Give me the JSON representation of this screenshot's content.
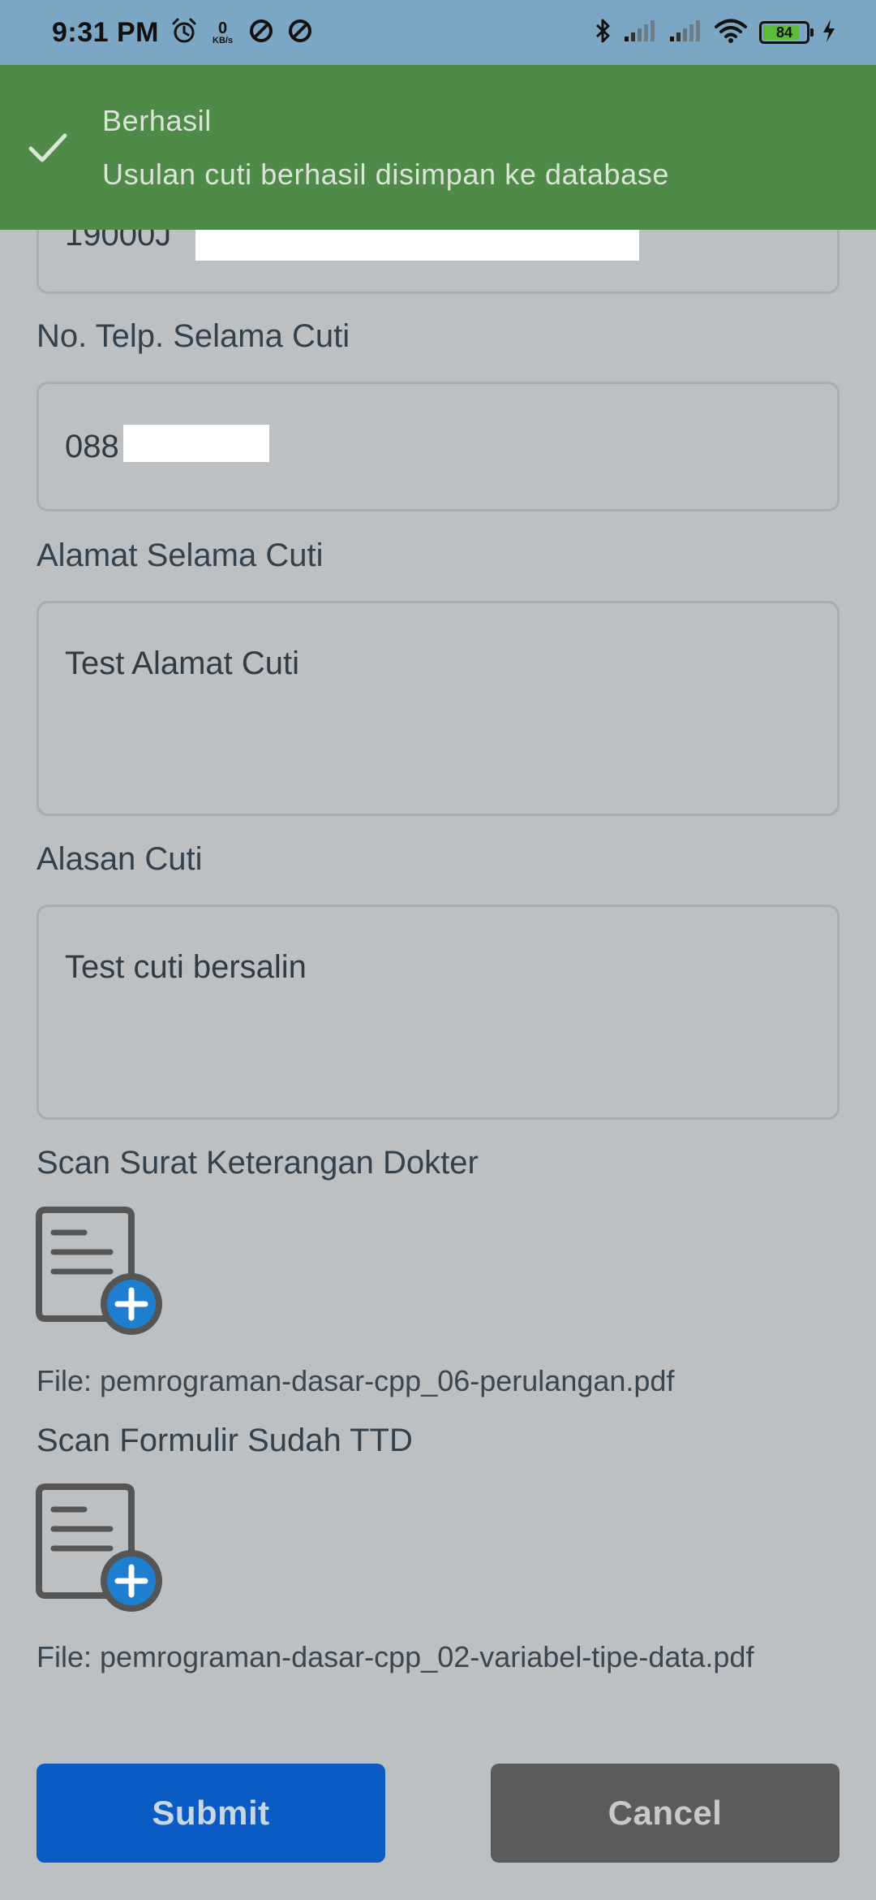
{
  "status_bar": {
    "time": "9:31 PM",
    "net_speed_value": "0",
    "net_speed_unit": "KB/s",
    "battery": "84",
    "icons": [
      "alarm-icon",
      "data-saver-icon",
      "data-saver-icon",
      "bluetooth-icon",
      "signal-icon",
      "signal-icon",
      "wifi-icon",
      "battery-icon",
      "charging-icon"
    ]
  },
  "toast": {
    "title": "Berhasil",
    "message": "Usulan cuti berhasil disimpan ke database",
    "background": "#4f8a49",
    "icon": "check-icon"
  },
  "form": {
    "partial_field_value": "19000J",
    "phone_label": "No. Telp. Selama Cuti",
    "phone_value": "088",
    "address_label": "Alamat Selama Cuti",
    "address_value": "Test Alamat Cuti",
    "reason_label": "Alasan Cuti",
    "reason_value": "Test cuti bersalin",
    "doctor_scan_label": "Scan Surat Keterangan Dokter",
    "doctor_scan_file": "File: pemrograman-dasar-cpp_06-perulangan.pdf",
    "form_scan_label": "Scan Formulir Sudah TTD",
    "form_scan_file": "File: pemrograman-dasar-cpp_02-variabel-tipe-data.pdf",
    "upload_icon": "add-document-icon"
  },
  "actions": {
    "submit_label": "Submit",
    "cancel_label": "Cancel",
    "submit_color": "#0a5bc4",
    "cancel_color": "#5b5b5b"
  }
}
